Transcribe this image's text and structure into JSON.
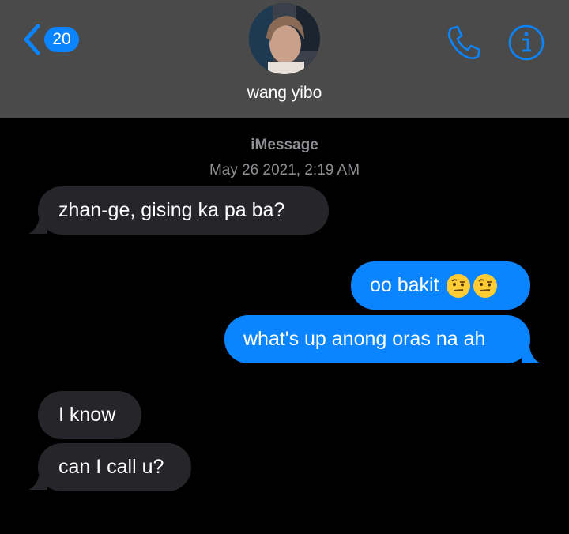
{
  "header": {
    "back_badge": "20",
    "contact_name": "wang yibo"
  },
  "conversation": {
    "service": "iMessage",
    "timestamp": "May 26 2021, 2:19 AM"
  },
  "messages": [
    {
      "direction": "incoming",
      "text": "zhan-ge, gising ka pa ba?"
    },
    {
      "direction": "outgoing",
      "text": "oo bakit",
      "emoji": [
        "face-with-raised-eyebrow-icon",
        "face-with-raised-eyebrow-icon"
      ]
    },
    {
      "direction": "outgoing",
      "text": "what's up anong oras na ah"
    },
    {
      "direction": "incoming",
      "text": "I know"
    },
    {
      "direction": "incoming",
      "text": "can I call u?"
    }
  ],
  "colors": {
    "header_bg": "#4a4a4a",
    "accent": "#0a84ff",
    "incoming_bubble": "#26252a",
    "meta_text": "#8e8e93"
  }
}
